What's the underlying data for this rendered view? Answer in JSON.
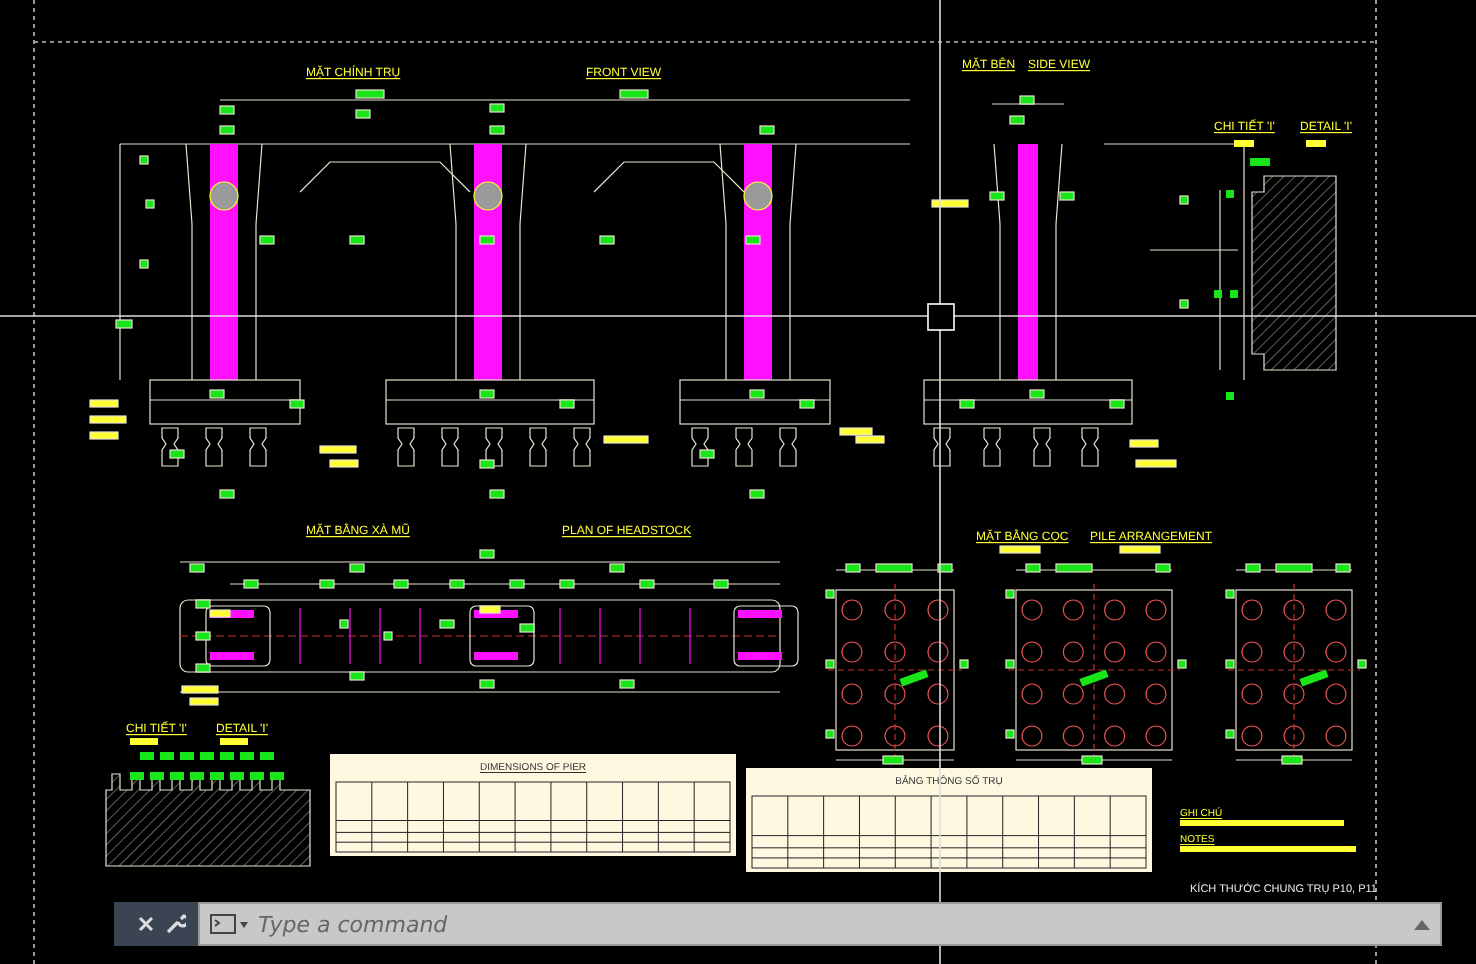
{
  "drawing": {
    "views": [
      {
        "kind": "front",
        "title": "MẶT CHÍNH TRỤ",
        "subtitle": "FRONT VIEW"
      },
      {
        "kind": "side",
        "title": "MẶT BÊN",
        "subtitle": "SIDE VIEW"
      },
      {
        "kind": "detail-top",
        "title": "CHI TIẾT 'I'",
        "subtitle": "DETAIL 'I'"
      },
      {
        "kind": "plan",
        "title": "MẶT BẰNG XÀ MŨ",
        "subtitle": "PLAN OF HEADSTOCK"
      },
      {
        "kind": "detail-bottom",
        "title": "CHI TIẾT 'I'",
        "subtitle": "DETAIL 'I'"
      },
      {
        "kind": "piles",
        "title": "MẶT BẰNG CỌC",
        "subtitle": "PILE ARRANGEMENT"
      }
    ],
    "tables": [
      {
        "kind": "dimensions",
        "title": "DIMENSIONS OF PIER"
      },
      {
        "kind": "parameters",
        "title": "BẢNG THÔNG SỐ TRỤ"
      }
    ],
    "notes": [
      {
        "label": "GHI CHÚ"
      },
      {
        "label": "NOTES"
      }
    ],
    "sheet_title": "KÍCH THƯỚC CHUNG TRỤ P10, P11"
  },
  "command_line": {
    "placeholder": "Type a command"
  }
}
